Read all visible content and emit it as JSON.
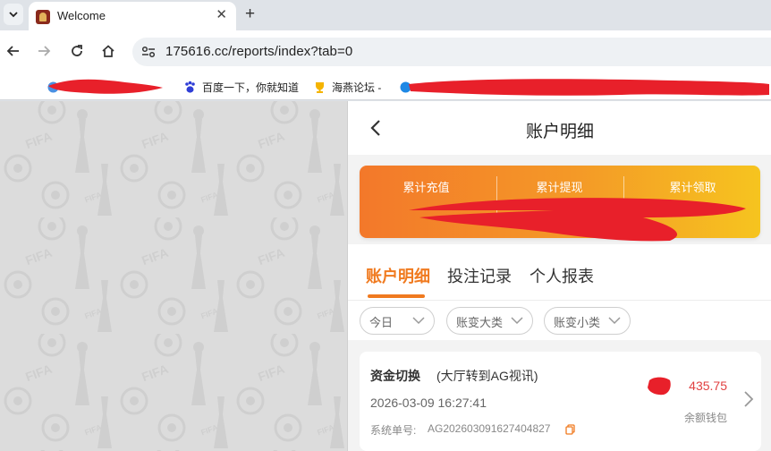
{
  "browser": {
    "tab": {
      "title": "Welcome",
      "favicon": "site-favicon"
    },
    "url": "175616.cc/reports/index?tab=0",
    "bookmarks": [
      {
        "label": "百度一下，你就知道",
        "icon": "baidu-paw-icon"
      },
      {
        "label": "海燕论坛 -",
        "icon": "trophy-icon"
      }
    ]
  },
  "header": {
    "title": "账户明细"
  },
  "summary": {
    "items": [
      {
        "label": "累计充值"
      },
      {
        "label": "累计提现"
      },
      {
        "label": "累计领取"
      }
    ]
  },
  "tabs": [
    {
      "label": "账户明细",
      "active": true
    },
    {
      "label": "投注记录",
      "active": false
    },
    {
      "label": "个人报表",
      "active": false
    }
  ],
  "filters": [
    {
      "label": "今日"
    },
    {
      "label": "账变大类"
    },
    {
      "label": "账变小类"
    }
  ],
  "record": {
    "type": "资金切换",
    "desc": "(大厅转到AG视讯)",
    "time": "2026-03-09 16:27:41",
    "order_label": "系统单号:",
    "order_no": "AG202603091627404827",
    "amount": "435.75",
    "wallet": "余额钱包"
  },
  "colors": {
    "accent": "#f07a1f",
    "gradient_start": "#f3782a",
    "gradient_end": "#f6c41f",
    "amount_red": "#e14141",
    "redaction": "#e8202a"
  }
}
